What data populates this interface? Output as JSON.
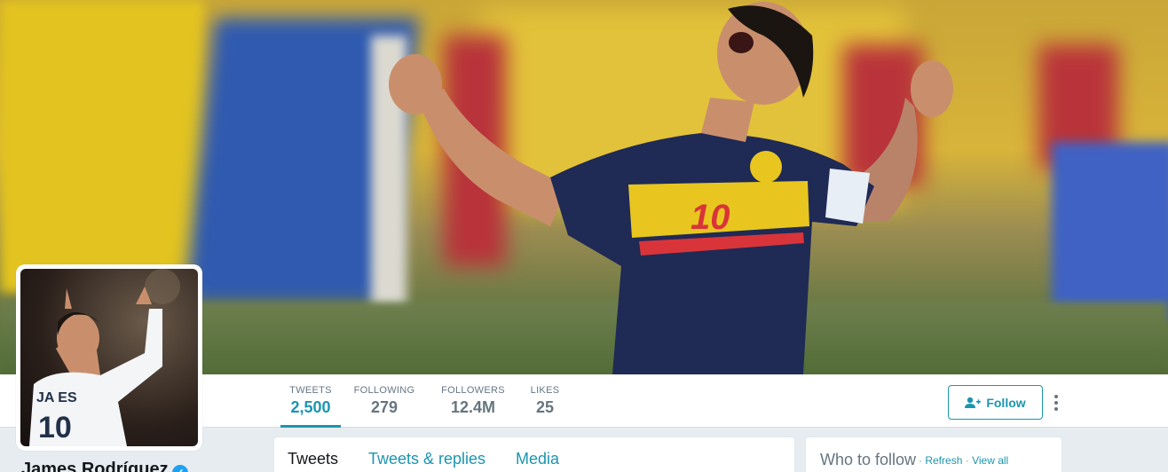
{
  "profile": {
    "name": "James Rodríguez"
  },
  "stats": [
    {
      "label": "TWEETS",
      "value": "2,500"
    },
    {
      "label": "FOLLOWING",
      "value": "279"
    },
    {
      "label": "FOLLOWERS",
      "value": "12.4M"
    },
    {
      "label": "LIKES",
      "value": "25"
    }
  ],
  "actions": {
    "follow_label": "Follow",
    "follow_icon": "user-plus-icon",
    "more_icon": "vertical-dots-icon"
  },
  "tabs": [
    {
      "label": "Tweets"
    },
    {
      "label": "Tweets & replies"
    },
    {
      "label": "Media"
    }
  ],
  "who_to_follow": {
    "title": "Who to follow",
    "separator": "·",
    "refresh": "Refresh",
    "view_all": "View all"
  },
  "colors": {
    "accent": "#1b95b0",
    "verified": "#1da1f2"
  }
}
